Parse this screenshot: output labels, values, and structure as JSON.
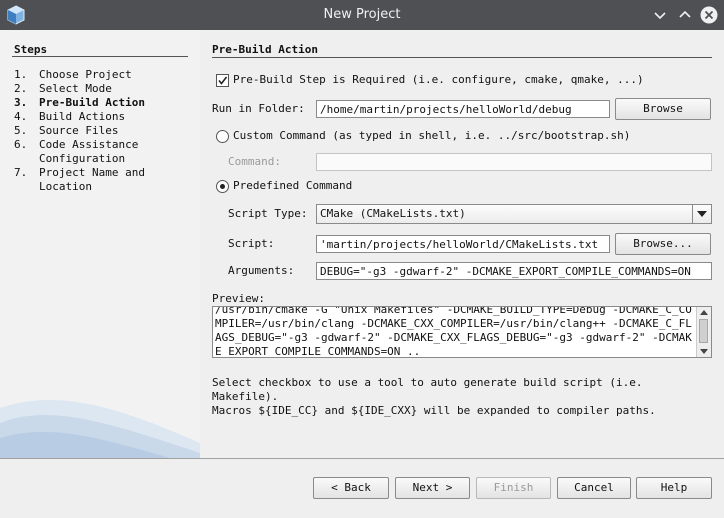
{
  "window": {
    "title": "New Project"
  },
  "steps": {
    "heading": "Steps",
    "items": [
      {
        "num": "1.",
        "label": "Choose Project",
        "active": false
      },
      {
        "num": "2.",
        "label": "Select Mode",
        "active": false
      },
      {
        "num": "3.",
        "label": "Pre-Build Action",
        "active": true
      },
      {
        "num": "4.",
        "label": "Build Actions",
        "active": false
      },
      {
        "num": "5.",
        "label": "Source Files",
        "active": false
      },
      {
        "num": "6.",
        "label": "Code Assistance\nConfiguration",
        "active": false
      },
      {
        "num": "7.",
        "label": "Project Name and\nLocation",
        "active": false
      }
    ]
  },
  "main": {
    "heading": "Pre-Build Action",
    "prebuild_checkbox": {
      "label": "Pre-Build Step is Required (i.e. configure, cmake, qmake, ...)",
      "checked": true
    },
    "run_in_folder": {
      "label": "Run in Folder:",
      "value": "/home/martin/projects/helloWorld/debug",
      "button": "Browse"
    },
    "custom_command": {
      "label": "Custom Command (as typed in shell, i.e. ../src/bootstrap.sh)",
      "selected": false
    },
    "command": {
      "label": "Command:",
      "value": ""
    },
    "predefined_command": {
      "label": "Predefined Command",
      "selected": true
    },
    "script_type": {
      "label": "Script Type:",
      "value": "CMake (CMakeLists.txt)"
    },
    "script": {
      "label": "Script:",
      "value": "'martin/projects/helloWorld/CMakeLists.txt",
      "button": "Browse..."
    },
    "arguments": {
      "label": "Arguments:",
      "value": "DEBUG=\"-g3 -gdwarf-2\" -DCMAKE_EXPORT_COMPILE_COMMANDS=ON"
    },
    "preview": {
      "label": "Preview:",
      "text": "/usr/bin/cmake -G \"Unix Makefiles\" -DCMAKE_BUILD_TYPE=Debug -DCMAKE_C_COMPILER=/usr/bin/clang -DCMAKE_CXX_COMPILER=/usr/bin/clang++ -DCMAKE_C_FLAGS_DEBUG=\"-g3 -gdwarf-2\" -DCMAKE_CXX_FLAGS_DEBUG=\"-g3 -gdwarf-2\" -DCMAKE_EXPORT_COMPILE_COMMANDS=ON .."
    },
    "help_line1": "Select checkbox to use a tool to auto generate build script (i.e.",
    "help_line2": "Makefile).",
    "help_line3": "Macros ${IDE_CC} and ${IDE_CXX} will be expanded to compiler paths."
  },
  "footer": {
    "back": "< Back",
    "next": "Next >",
    "finish": "Finish",
    "cancel": "Cancel",
    "help": "Help"
  }
}
